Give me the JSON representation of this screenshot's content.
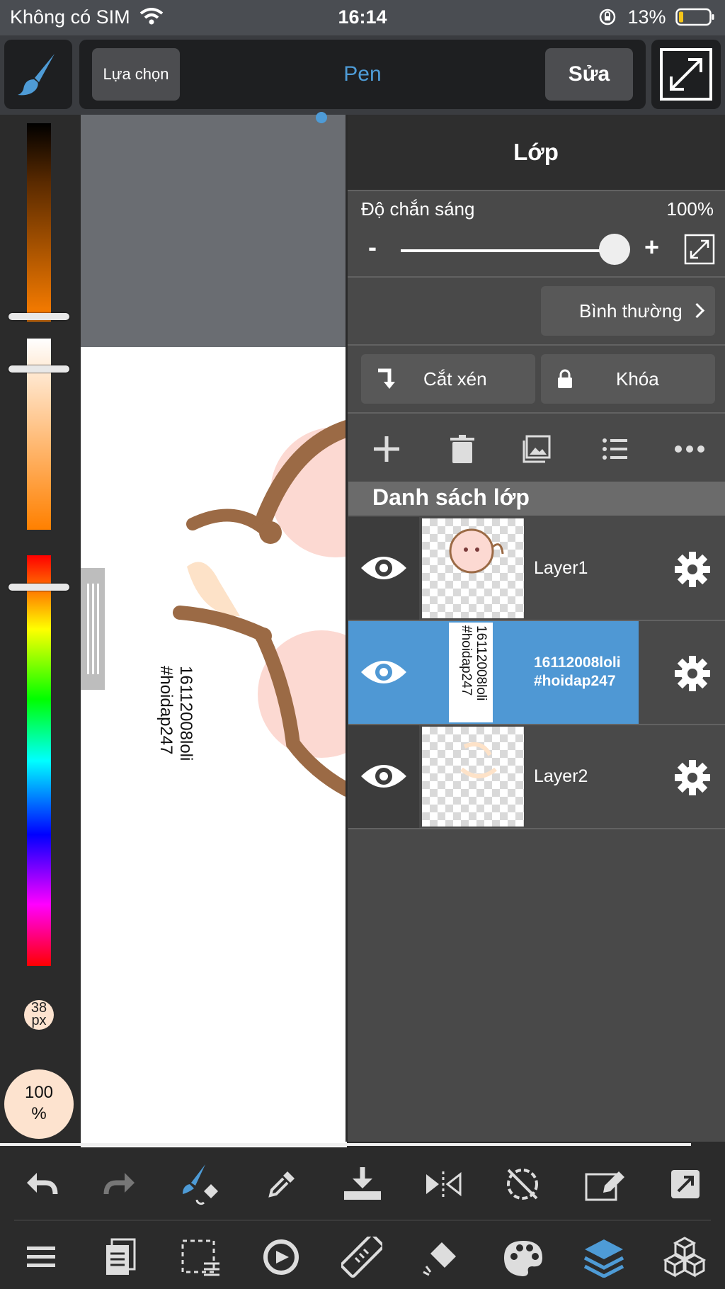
{
  "status": {
    "carrier": "Không có SIM",
    "time": "16:14",
    "battery": "13%"
  },
  "toolbar": {
    "select_label": "Lựa chọn",
    "tool_name": "Pen",
    "edit_label": "Sửa"
  },
  "brush": {
    "size": "38\npx",
    "size_num": "38",
    "size_unit": "px",
    "opacity_num": "100",
    "opacity_unit": "%"
  },
  "canvas": {
    "text_line1": "16112008loli",
    "text_line2": "#hoidap247"
  },
  "panel": {
    "title": "Lớp",
    "opacity_label": "Độ chắn sáng",
    "opacity_value": "100%",
    "minus": "-",
    "plus": "+",
    "blend_mode": "Bình thường",
    "clip_label": "Cắt xén",
    "lock_label": "Khóa",
    "list_title": "Danh sách lớp",
    "opacity_level": 1.0
  },
  "layers": [
    {
      "name": "Layer1",
      "selected": false
    },
    {
      "name": "16112008loli\n#hoidap247",
      "line1": "16112008loli",
      "line2": "#hoidap247",
      "selected": true
    },
    {
      "name": "Layer2",
      "selected": false
    }
  ],
  "colors": {
    "accent": "#4e9bd6",
    "selected_row": "#4f98d4",
    "brush_preview": "#fde3cf"
  },
  "icons": {
    "bottom_row1": [
      "undo-icon",
      "redo-icon",
      "brush-swap-icon",
      "eyedropper-icon",
      "import-icon",
      "flip-icon",
      "rotate-off-icon",
      "edit-page-icon",
      "export-icon"
    ],
    "bottom_row2": [
      "menu-icon",
      "pages-icon",
      "selection-icon",
      "transform-icon",
      "ruler-icon",
      "fill-icon",
      "palette-icon",
      "layers-icon",
      "materials-icon"
    ]
  }
}
